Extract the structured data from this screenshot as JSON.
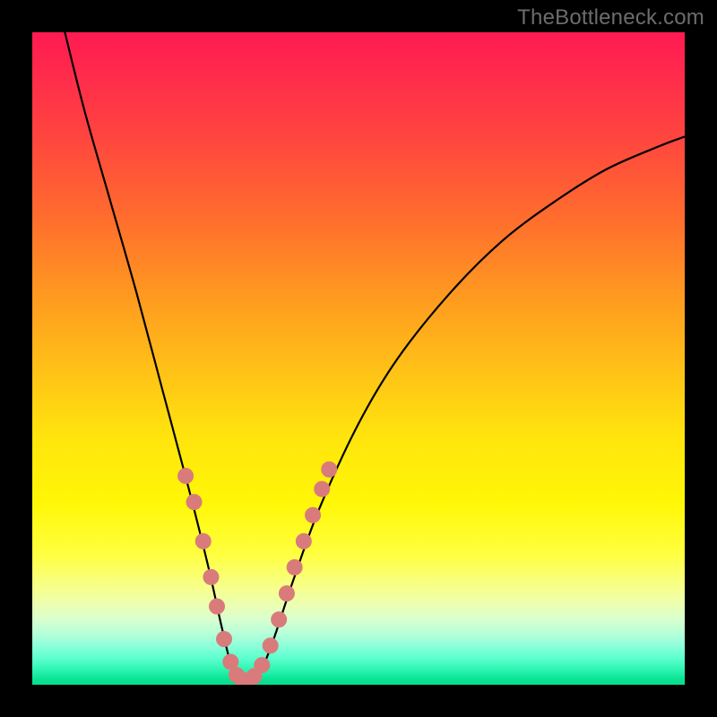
{
  "watermark": "TheBottleneck.com",
  "colors": {
    "curve_stroke": "#000000",
    "marker_fill": "#d97b7b",
    "marker_stroke": "#d97b7b"
  },
  "chart_data": {
    "type": "line",
    "title": "",
    "xlabel": "",
    "ylabel": "",
    "xlim": [
      0,
      100
    ],
    "ylim": [
      0,
      100
    ],
    "grid": false,
    "legend": false,
    "series": [
      {
        "name": "bottleneck-curve",
        "x": [
          5,
          8,
          12,
          16,
          20,
          24,
          27,
          29,
          30.5,
          32,
          33.5,
          35,
          37,
          40,
          44,
          50,
          56,
          64,
          72,
          80,
          88,
          96,
          100
        ],
        "y": [
          100,
          88,
          74,
          60,
          45,
          30,
          18,
          9,
          3,
          0.5,
          0.5,
          2,
          7,
          16,
          27,
          40,
          50,
          60,
          68,
          74,
          79,
          82.5,
          84
        ]
      }
    ],
    "markers": [
      {
        "x": 23.5,
        "y": 32
      },
      {
        "x": 24.8,
        "y": 28
      },
      {
        "x": 26.2,
        "y": 22
      },
      {
        "x": 27.4,
        "y": 16.5
      },
      {
        "x": 28.3,
        "y": 12
      },
      {
        "x": 29.4,
        "y": 7
      },
      {
        "x": 30.4,
        "y": 3.5
      },
      {
        "x": 31.3,
        "y": 1.5
      },
      {
        "x": 32.2,
        "y": 0.7
      },
      {
        "x": 33.1,
        "y": 0.7
      },
      {
        "x": 34.0,
        "y": 1.3
      },
      {
        "x": 35.2,
        "y": 3
      },
      {
        "x": 36.5,
        "y": 6
      },
      {
        "x": 37.8,
        "y": 10
      },
      {
        "x": 39.0,
        "y": 14
      },
      {
        "x": 40.2,
        "y": 18
      },
      {
        "x": 41.6,
        "y": 22
      },
      {
        "x": 43.0,
        "y": 26
      },
      {
        "x": 44.4,
        "y": 30
      },
      {
        "x": 45.5,
        "y": 33
      }
    ],
    "marker_radius_px": 8.5
  }
}
